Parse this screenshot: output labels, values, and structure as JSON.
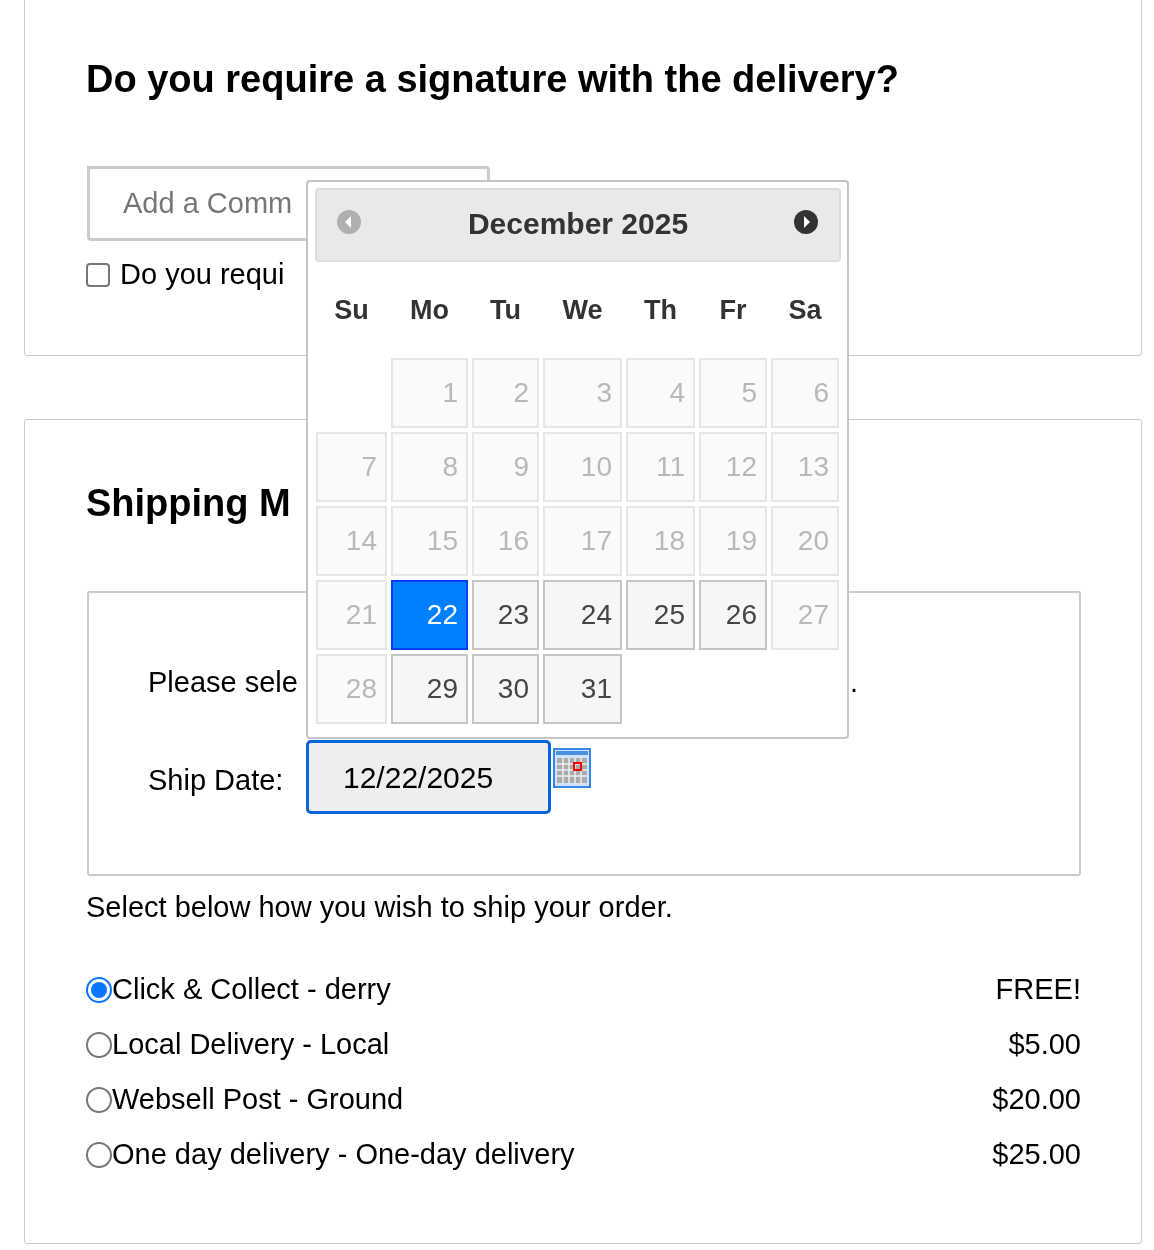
{
  "signature_section": {
    "heading": "Do you require a signature with the delivery?",
    "comment": {
      "placeholder": "Add a Comm"
    },
    "checkbox": {
      "label": "Do you requi",
      "checked": false
    }
  },
  "shipping_section": {
    "heading": "Shipping M",
    "date_box": {
      "instruction": "Please sele",
      "instruction_tail": ".",
      "label": "Ship Date:",
      "value": "12/22/2025"
    },
    "note": "Select below how you wish to ship your order.",
    "options": [
      {
        "label": "Click & Collect - derry",
        "price": "FREE!",
        "selected": true
      },
      {
        "label": "Local Delivery - Local",
        "price": "$5.00",
        "selected": false
      },
      {
        "label": "Websell Post - Ground",
        "price": "$20.00",
        "selected": false
      },
      {
        "label": "One day delivery - One-day delivery",
        "price": "$25.00",
        "selected": false
      }
    ]
  },
  "datepicker": {
    "title": "December 2025",
    "prev_disabled": true,
    "next_disabled": false,
    "weekdays": [
      "Su",
      "Mo",
      "Tu",
      "We",
      "Th",
      "Fr",
      "Sa"
    ],
    "weeks": [
      [
        {
          "kind": "blank"
        },
        {
          "label": "1",
          "disabled": true,
          "selected": false
        },
        {
          "label": "2",
          "disabled": true,
          "selected": false
        },
        {
          "label": "3",
          "disabled": true,
          "selected": false
        },
        {
          "label": "4",
          "disabled": true,
          "selected": false
        },
        {
          "label": "5",
          "disabled": true,
          "selected": false
        },
        {
          "label": "6",
          "disabled": true,
          "selected": false
        }
      ],
      [
        {
          "label": "7",
          "disabled": true,
          "selected": false
        },
        {
          "label": "8",
          "disabled": true,
          "selected": false
        },
        {
          "label": "9",
          "disabled": true,
          "selected": false
        },
        {
          "label": "10",
          "disabled": true,
          "selected": false
        },
        {
          "label": "11",
          "disabled": true,
          "selected": false
        },
        {
          "label": "12",
          "disabled": true,
          "selected": false
        },
        {
          "label": "13",
          "disabled": true,
          "selected": false
        }
      ],
      [
        {
          "label": "14",
          "disabled": true,
          "selected": false
        },
        {
          "label": "15",
          "disabled": true,
          "selected": false
        },
        {
          "label": "16",
          "disabled": true,
          "selected": false
        },
        {
          "label": "17",
          "disabled": true,
          "selected": false
        },
        {
          "label": "18",
          "disabled": true,
          "selected": false
        },
        {
          "label": "19",
          "disabled": true,
          "selected": false
        },
        {
          "label": "20",
          "disabled": true,
          "selected": false
        }
      ],
      [
        {
          "label": "21",
          "disabled": true,
          "selected": false
        },
        {
          "label": "22",
          "disabled": false,
          "selected": true
        },
        {
          "label": "23",
          "disabled": false,
          "selected": false
        },
        {
          "label": "24",
          "disabled": false,
          "selected": false
        },
        {
          "label": "25",
          "disabled": false,
          "selected": false
        },
        {
          "label": "26",
          "disabled": false,
          "selected": false
        },
        {
          "label": "27",
          "disabled": true,
          "selected": false
        }
      ],
      [
        {
          "label": "28",
          "disabled": true,
          "selected": false
        },
        {
          "label": "29",
          "disabled": false,
          "selected": false
        },
        {
          "label": "30",
          "disabled": false,
          "selected": false
        },
        {
          "label": "31",
          "disabled": false,
          "selected": false
        }
      ]
    ]
  }
}
